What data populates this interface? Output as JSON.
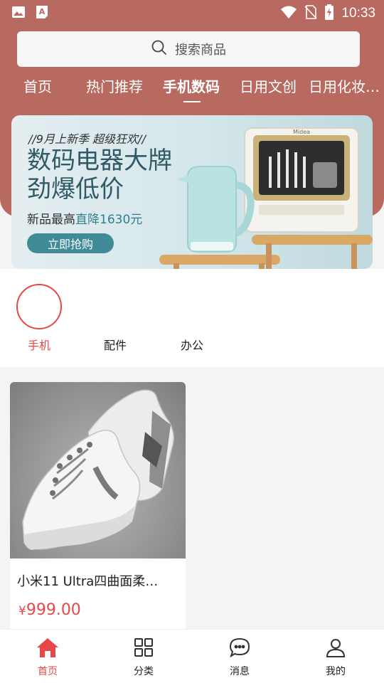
{
  "status_bar": {
    "time": "10:33",
    "icons": [
      "image-icon",
      "text-icon",
      "wifi-icon",
      "no-sim-icon",
      "battery-charging-icon"
    ]
  },
  "search": {
    "placeholder": "搜索商品"
  },
  "tabs": [
    {
      "label": "首页",
      "active": false
    },
    {
      "label": "热门推荐",
      "active": false
    },
    {
      "label": "手机数码",
      "active": true
    },
    {
      "label": "日用文创",
      "active": false
    },
    {
      "label": "日用化妆…",
      "active": false
    }
  ],
  "banner": {
    "kicker": "//9月上新季 超级狂欢//",
    "title_line1": "数码电器大牌",
    "title_line2": "劲爆低价",
    "subtitle_prefix": "新品最高",
    "subtitle_highlight": "直降1630元",
    "button": "立即抢购",
    "brand_text": "Midea"
  },
  "categories": [
    {
      "label": "手机",
      "active": true
    },
    {
      "label": "配件",
      "active": false
    },
    {
      "label": "办公",
      "active": false
    }
  ],
  "products": [
    {
      "name": "小米11 Ultra四曲面柔…",
      "currency": "¥",
      "price": "999.00"
    }
  ],
  "bottom_nav": [
    {
      "label": "首页",
      "icon": "home-icon",
      "active": true
    },
    {
      "label": "分类",
      "icon": "grid-icon",
      "active": false
    },
    {
      "label": "消息",
      "icon": "chat-icon",
      "active": false
    },
    {
      "label": "我的",
      "icon": "user-icon",
      "active": false
    }
  ],
  "colors": {
    "header": "#b86a60",
    "accent": "#e84747",
    "banner_button": "#3f8b98"
  }
}
